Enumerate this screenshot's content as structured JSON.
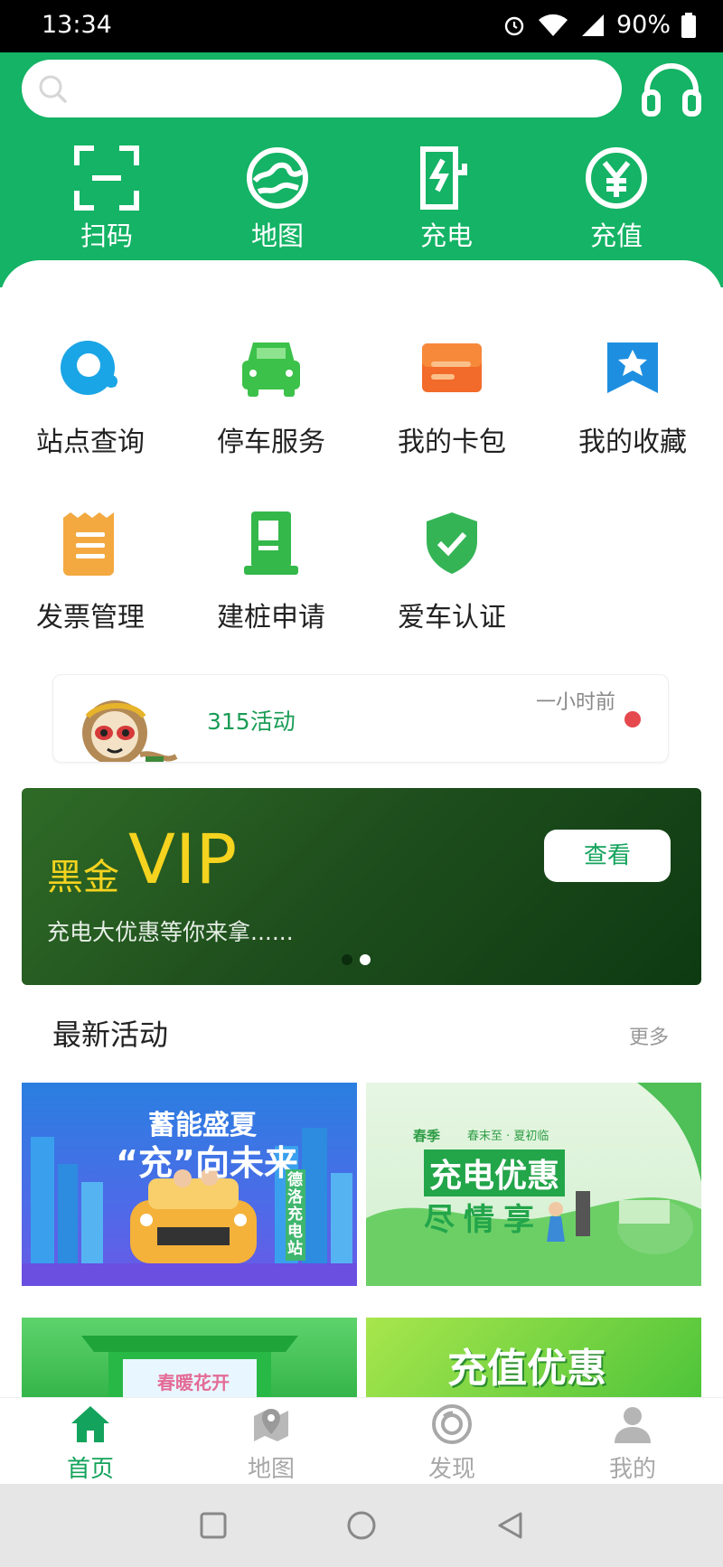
{
  "status_bar": {
    "time": "13:34",
    "battery": "90%"
  },
  "search": {
    "placeholder": ""
  },
  "top_actions": [
    {
      "label": "扫码",
      "icon": "scan-icon"
    },
    {
      "label": "地图",
      "icon": "map-icon"
    },
    {
      "label": "充电",
      "icon": "charge-icon"
    },
    {
      "label": "充值",
      "icon": "yen-icon"
    }
  ],
  "services": [
    {
      "label": "站点查询",
      "icon": "station-search-icon",
      "color": "#1aa5e6"
    },
    {
      "label": "停车服务",
      "icon": "car-icon",
      "color": "#3cc14a"
    },
    {
      "label": "我的卡包",
      "icon": "card-icon",
      "color": "#f26b2a"
    },
    {
      "label": "我的收藏",
      "icon": "star-bookmark-icon",
      "color": "#1e8fe0"
    },
    {
      "label": "发票管理",
      "icon": "invoice-icon",
      "color": "#f3a940"
    },
    {
      "label": "建桩申请",
      "icon": "charging-pile-icon",
      "color": "#34b84a"
    },
    {
      "label": "爱车认证",
      "icon": "shield-check-icon",
      "color": "#35b456"
    }
  ],
  "notice": {
    "title": "315活动",
    "time_ago": "一小时前"
  },
  "banner": {
    "prefix": "黑金",
    "vip": "VIP",
    "subtitle": "充电大优惠等你来拿......",
    "button": "查看"
  },
  "section": {
    "title": "最新活动",
    "more": "更多"
  },
  "promos": [
    {
      "line1": "蓄能盛夏",
      "line2": "“充”向未来",
      "side": "德洛充电站"
    },
    {
      "tag": "春季",
      "subtag": "春末至 · 夏初临",
      "line1": "充电优惠",
      "line2": "尽情享"
    },
    {
      "line1": "春暖花开"
    },
    {
      "line1": "充值优惠"
    }
  ],
  "tabbar": [
    {
      "label": "首页",
      "icon": "home-icon",
      "active": true
    },
    {
      "label": "地图",
      "icon": "map-pin-icon",
      "active": false
    },
    {
      "label": "发现",
      "icon": "discover-icon",
      "active": false
    },
    {
      "label": "我的",
      "icon": "user-icon",
      "active": false
    }
  ],
  "colors": {
    "brand": "#14b365",
    "active_tab": "#14a35c",
    "inactive_tab": "#a8a8a8"
  }
}
